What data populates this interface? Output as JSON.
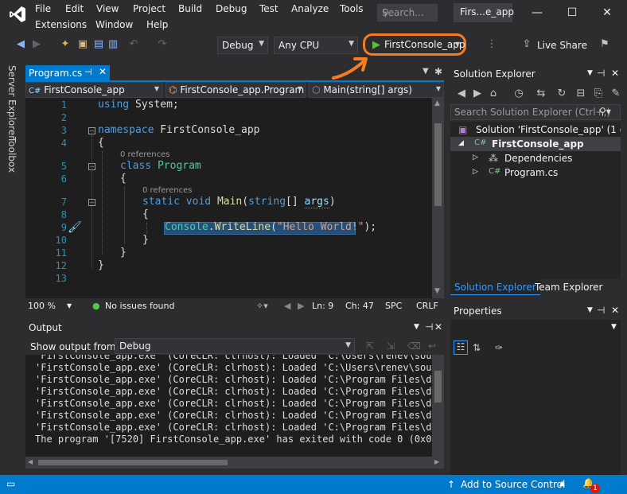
{
  "menu": {
    "items": [
      "File",
      "Edit",
      "View",
      "Project",
      "Build",
      "Debug",
      "Test",
      "Analyze",
      "Tools",
      "Extensions",
      "Window",
      "Help"
    ],
    "search_placeholder": "Search...",
    "window_title": "Firs...e_app"
  },
  "toolbar": {
    "config": "Debug",
    "platform": "Any CPU",
    "run_label": "FirstConsole_app",
    "live_share": "Live Share",
    "accent_color": "#f57c20"
  },
  "left_rail": {
    "server_explorer": "Server Explorer",
    "toolbox": "Toolbox"
  },
  "editor": {
    "tab_label": "Program.cs",
    "nav": {
      "project": "FirstConsole_app",
      "class": "FirstConsole_app.Program",
      "member": "Main(string[] args)"
    },
    "line_numbers": [
      "1",
      "2",
      "3",
      "4",
      "5",
      "6",
      "7",
      "8",
      "9",
      "10",
      "11",
      "12",
      "13"
    ],
    "code": {
      "l1_kw": "using",
      "l1_rest": " System;",
      "l3_kw": "namespace",
      "l3_rest": " FirstConsole_app",
      "brace_open": "{",
      "brace_close": "}",
      "ref_label": "0 references",
      "l5_kw": "class",
      "l5_ty": "Program",
      "l7_kw1": "static",
      "l7_kw2": "void",
      "l7_fn": "Main",
      "l7_p1": "(",
      "l7_kw3": "string",
      "l7_p2": "[] ",
      "l7_arg": "args",
      "l7_p3": ")",
      "l9_ty": "Console",
      "l9_dot": ".",
      "l9_fn": "WriteLine",
      "l9_p1": "(",
      "l9_str": "\"Hello World!\"",
      "l9_p2": ");"
    },
    "status": {
      "zoom": "100 %",
      "issues": "No issues found",
      "line": "Ln: 9",
      "col": "Ch: 47",
      "mode": "SPC",
      "eol": "CRLF"
    }
  },
  "output": {
    "title": "Output",
    "show_from_label": "Show output from:",
    "source": "Debug",
    "lines": [
      "'FirstConsole_app.exe' (CoreCLR: clrhost): Loaded 'C:\\Users\\renev\\sourc",
      "'FirstConsole_app.exe' (CoreCLR: clrhost): Loaded 'C:\\Program Files\\dot",
      "'FirstConsole_app.exe' (CoreCLR: clrhost): Loaded 'C:\\Program Files\\dot",
      "'FirstConsole_app.exe' (CoreCLR: clrhost): Loaded 'C:\\Program Files\\dot",
      "'FirstConsole_app.exe' (CoreCLR: clrhost): Loaded 'C:\\Program Files\\dot",
      "'FirstConsole_app.exe' (CoreCLR: clrhost): Loaded 'C:\\Program Files\\dot",
      "The program '[7520] FirstConsole_app.exe' has exited with code 0 (0x0)."
    ]
  },
  "solution_explorer": {
    "title": "Solution Explorer",
    "search_placeholder": "Search Solution Explorer (Ctrl+;)",
    "tree": {
      "solution": "Solution 'FirstConsole_app' (1 of 1",
      "project": "FirstConsole_app",
      "dependencies": "Dependencies",
      "file": "Program.cs"
    },
    "tabs": [
      "Solution Explorer",
      "Team Explorer"
    ]
  },
  "properties": {
    "title": "Properties"
  },
  "statusbar": {
    "source_control": "Add to Source Control",
    "notifications": "1"
  }
}
